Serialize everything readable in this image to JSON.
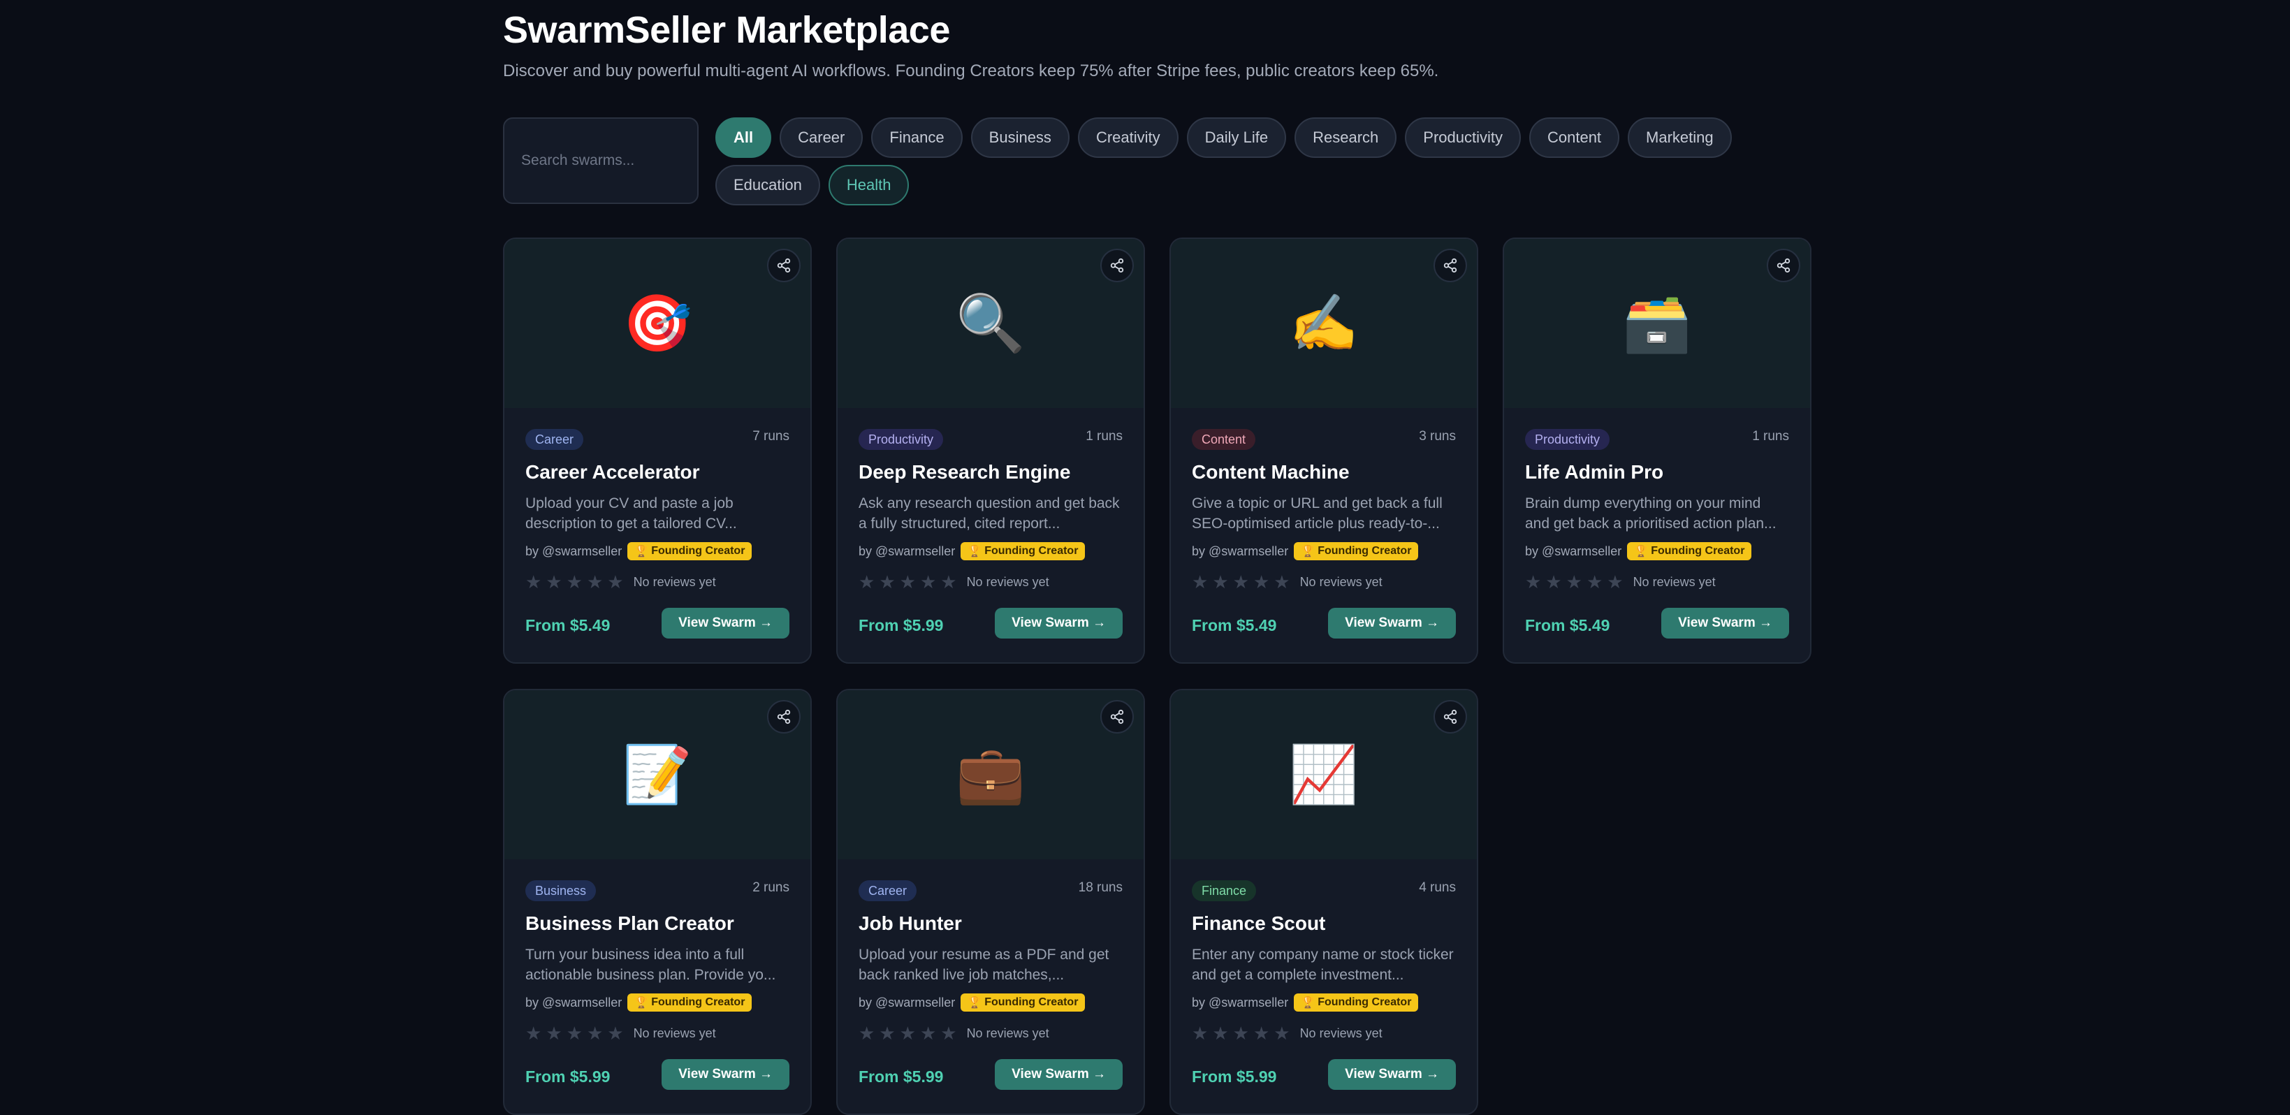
{
  "header": {
    "title": "SwarmSeller Marketplace",
    "subtitle": "Discover and buy powerful multi-agent AI workflows. Founding Creators keep 75% after Stripe fees, public creators keep 65%."
  },
  "search": {
    "placeholder": "Search swarms..."
  },
  "filters": [
    "All",
    "Career",
    "Finance",
    "Business",
    "Creativity",
    "Daily Life",
    "Research",
    "Productivity",
    "Content",
    "Marketing",
    "Education",
    "Health"
  ],
  "active_filter": "All",
  "cards": [
    {
      "icon": "🎯",
      "icon_name": "target-icon",
      "category": "Career",
      "runs": "7 runs",
      "title": "Career Accelerator",
      "description": "Upload your CV and paste a job description to get a tailored CV...",
      "author": "by @swarmseller",
      "badge": "Founding Creator",
      "reviews": "No reviews yet",
      "price": "From $5.49",
      "cta": "View Swarm →"
    },
    {
      "icon": "🔍",
      "icon_name": "magnifier-icon",
      "category": "Productivity",
      "runs": "1 runs",
      "title": "Deep Research Engine",
      "description": "Ask any research question and get back a fully structured, cited report...",
      "author": "by @swarmseller",
      "badge": "Founding Creator",
      "reviews": "No reviews yet",
      "price": "From $5.99",
      "cta": "View Swarm →"
    },
    {
      "icon": "✍️",
      "icon_name": "writing-hand-icon",
      "category": "Content",
      "runs": "3 runs",
      "title": "Content Machine",
      "description": "Give a topic or URL and get back a full SEO-optimised article plus ready-to-...",
      "author": "by @swarmseller",
      "badge": "Founding Creator",
      "reviews": "No reviews yet",
      "price": "From $5.49",
      "cta": "View Swarm →"
    },
    {
      "icon": "🗃️",
      "icon_name": "card-file-box-icon",
      "category": "Productivity",
      "runs": "1 runs",
      "title": "Life Admin Pro",
      "description": "Brain dump everything on your mind and get back a prioritised action plan...",
      "author": "by @swarmseller",
      "badge": "Founding Creator",
      "reviews": "No reviews yet",
      "price": "From $5.49",
      "cta": "View Swarm →"
    },
    {
      "icon": "📝",
      "icon_name": "memo-icon",
      "category": "Business",
      "runs": "2 runs",
      "title": "Business Plan Creator",
      "description": "Turn your business idea into a full actionable business plan. Provide yo...",
      "author": "by @swarmseller",
      "badge": "Founding Creator",
      "reviews": "No reviews yet",
      "price": "From $5.99",
      "cta": "View Swarm →"
    },
    {
      "icon": "💼",
      "icon_name": "briefcase-icon",
      "category": "Career",
      "runs": "18 runs",
      "title": "Job Hunter",
      "description": "Upload your resume as a PDF and get back ranked live job matches,...",
      "author": "by @swarmseller",
      "badge": "Founding Creator",
      "reviews": "No reviews yet",
      "price": "From $5.99",
      "cta": "View Swarm →"
    },
    {
      "icon": "📈",
      "icon_name": "chart-increasing-icon",
      "category": "Finance",
      "runs": "4 runs",
      "title": "Finance Scout",
      "description": "Enter any company name or stock ticker and get a complete investment...",
      "author": "by @swarmseller",
      "badge": "Founding Creator",
      "reviews": "No reviews yet",
      "price": "From $5.99",
      "cta": "View Swarm →"
    }
  ]
}
